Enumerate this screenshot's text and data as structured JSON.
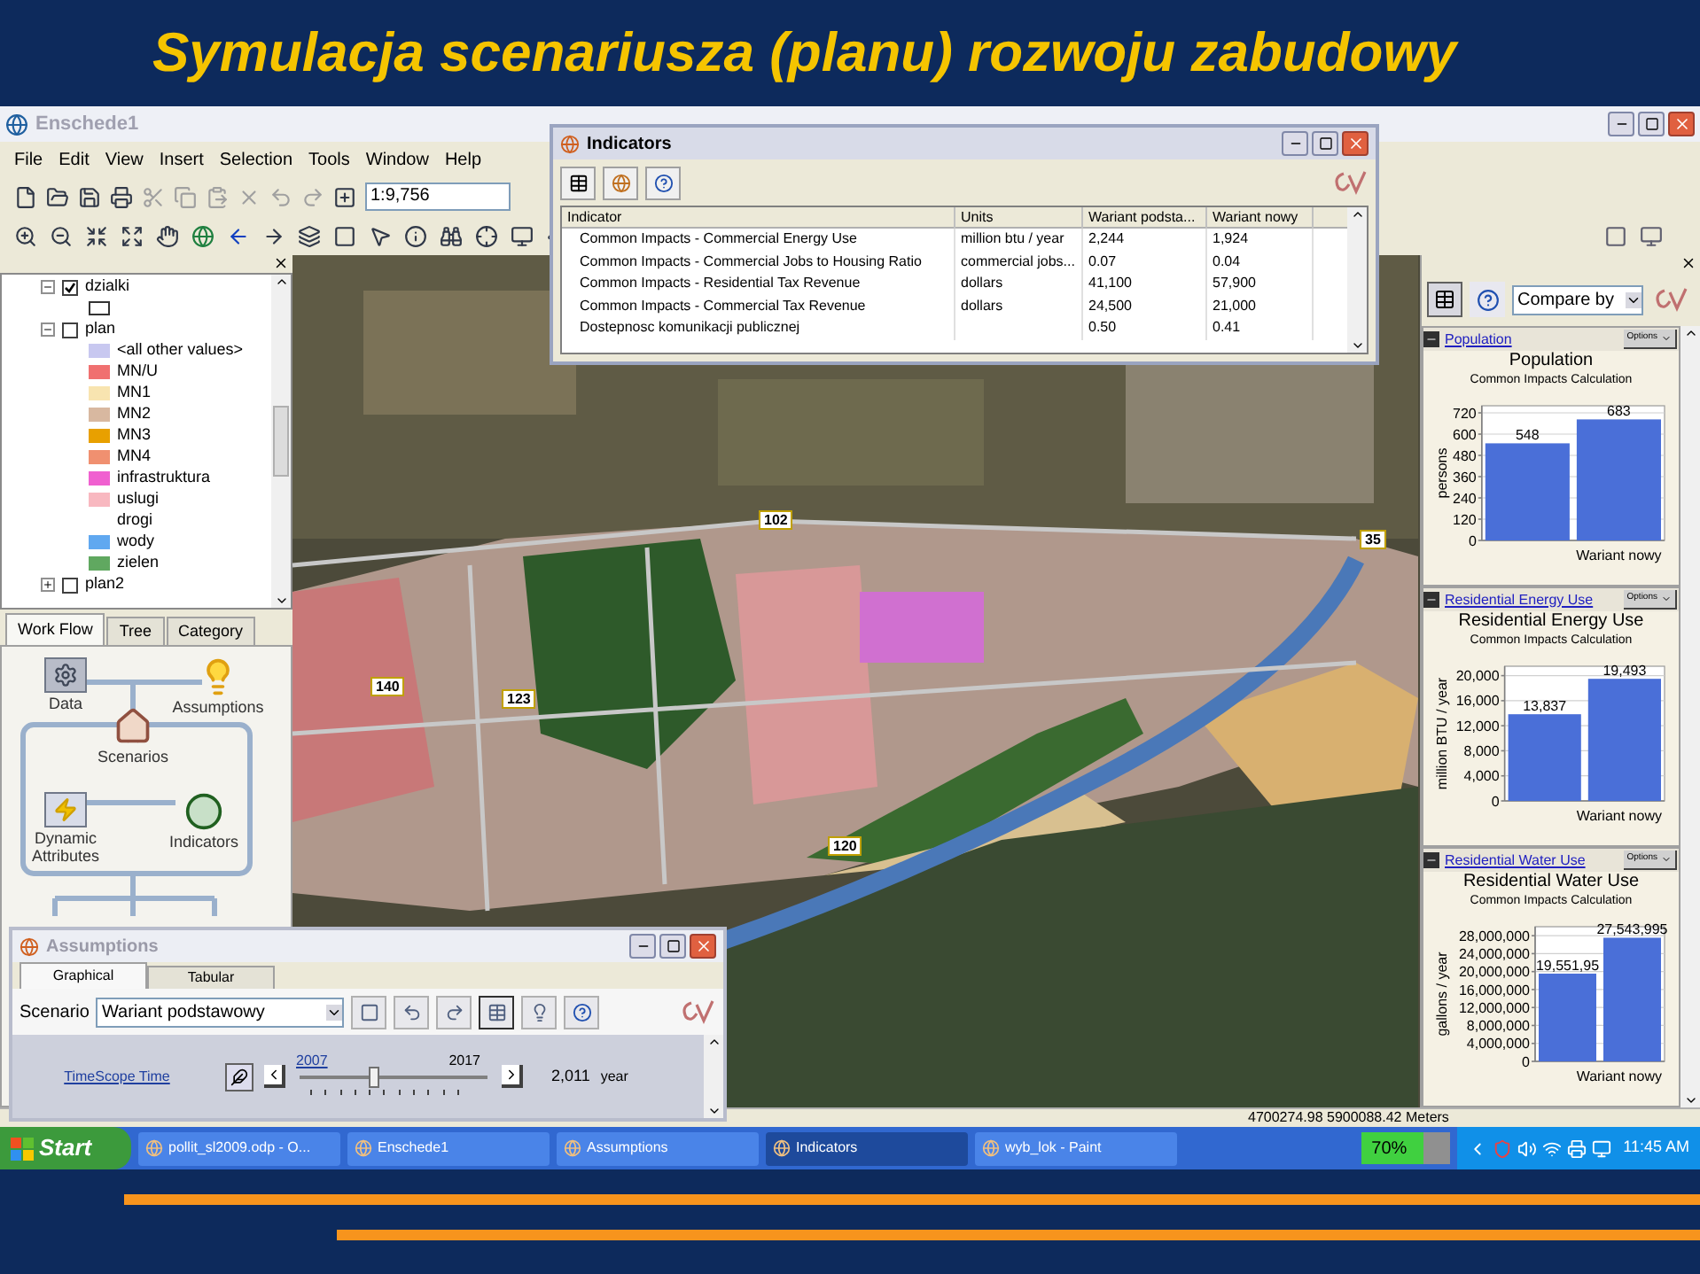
{
  "slide": {
    "title": "Symulacja scenariusza (planu) rozwoju zabudowy"
  },
  "app": {
    "title": "Enschede1",
    "active": false,
    "menu": [
      "File",
      "Edit",
      "View",
      "Insert",
      "Selection",
      "Tools",
      "Window",
      "Help"
    ],
    "scale": "1:9,756"
  },
  "toc": [
    {
      "label": "dzialki",
      "checked": true,
      "expanded": true,
      "legend": [
        {
          "kind": "outline",
          "color": "#ffffff"
        }
      ]
    },
    {
      "label": "plan",
      "checked": false,
      "expanded": true,
      "legend": [
        {
          "kind": "swatch",
          "label": "<all other values>",
          "color": "#c8c8f0"
        },
        {
          "kind": "swatch",
          "label": "MN/U",
          "color": "#f07070"
        },
        {
          "kind": "swatch",
          "label": "MN1",
          "color": "#f8e4b0"
        },
        {
          "kind": "swatch",
          "label": "MN2",
          "color": "#d8b8a0"
        },
        {
          "kind": "swatch",
          "label": "MN3",
          "color": "#e8a000"
        },
        {
          "kind": "swatch",
          "label": "MN4",
          "color": "#f09070"
        },
        {
          "kind": "swatch",
          "label": "infrastruktura",
          "color": "#f060d0"
        },
        {
          "kind": "swatch",
          "label": "uslugi",
          "color": "#f8b8c0"
        },
        {
          "kind": "blank",
          "label": "drogi"
        },
        {
          "kind": "swatch",
          "label": "wody",
          "color": "#60a8f0"
        },
        {
          "kind": "swatch",
          "label": "zielen",
          "color": "#60a860"
        }
      ]
    },
    {
      "label": "plan2",
      "checked": false,
      "expanded": false
    }
  ],
  "left_tabs": [
    {
      "label": "Work Flow",
      "selected": true
    },
    {
      "label": "Tree",
      "selected": false
    },
    {
      "label": "Category",
      "selected": false
    }
  ],
  "workflow": [
    {
      "kind": "data",
      "label": "Data"
    },
    {
      "kind": "assumptions",
      "label": "Assumptions"
    },
    {
      "kind": "scenarios",
      "label": "Scenarios"
    },
    {
      "kind": "dynamic",
      "label": "Dynamic Attributes"
    },
    {
      "kind": "indicators",
      "label": "Indicators"
    }
  ],
  "map": {
    "labels": [
      "102",
      "35",
      "140",
      "123",
      "120"
    ]
  },
  "indicators_window": {
    "title": "Indicators",
    "active": true,
    "columns": [
      "Indicator",
      "Units",
      "Wariant podsta...",
      "Wariant nowy"
    ],
    "rows": [
      [
        "Common Impacts - Commercial Energy Use",
        "million btu / year",
        "2,244",
        "1,924"
      ],
      [
        "Common Impacts - Commercial Jobs to Housing Ratio",
        "commercial jobs...",
        "0.07",
        "0.04"
      ],
      [
        "Common Impacts - Residential Tax Revenue",
        "dollars",
        "41,100",
        "57,900"
      ],
      [
        "Common Impacts - Commercial Tax Revenue",
        "dollars",
        "24,500",
        "21,000"
      ],
      [
        "Dostepnosc komunikacji publicznej",
        null,
        "0.50",
        "0.41"
      ]
    ]
  },
  "right_panel": {
    "compare": "Compare by",
    "sections": [
      {
        "link": "Population",
        "options": "Options",
        "subtitle": "Common Impacts Calculation",
        "chart_data": {
          "type": "bar",
          "title": "Population",
          "ylabel": "persons",
          "categories": [
            null,
            "Wariant nowy"
          ],
          "values": [
            548,
            683
          ],
          "grid": true,
          "ylim": [
            0,
            760
          ],
          "yticks": [
            0,
            120,
            240,
            360,
            480,
            600,
            720
          ],
          "value_labels": [
            "548",
            "683"
          ]
        }
      },
      {
        "link": "Residential Energy Use",
        "options": "Options",
        "subtitle": "Common Impacts Calculation",
        "chart_data": {
          "type": "bar",
          "title": "Residential Energy Use",
          "ylabel": "million BTU / year",
          "categories": [
            null,
            "Wariant nowy"
          ],
          "values": [
            13837,
            19493
          ],
          "grid": true,
          "ylim": [
            0,
            21500
          ],
          "yticks": [
            0,
            {
              "value": 4000,
              "label": "4,000"
            },
            {
              "value": 8000,
              "label": "8,000"
            },
            {
              "value": 12000,
              "label": "12,000"
            },
            {
              "value": 16000,
              "label": "16,000"
            },
            {
              "value": 20000,
              "label": "20,000"
            }
          ],
          "value_labels": [
            "13,837",
            "19,493"
          ]
        }
      },
      {
        "link": "Residential Water Use",
        "options": "Options",
        "subtitle": "Common Impacts Calculation",
        "chart_data": {
          "type": "bar",
          "title": "Residential Water Use",
          "ylabel": "gallons / year",
          "categories": [
            null,
            "Wariant nowy"
          ],
          "values": [
            19550000,
            27543995
          ],
          "ylim": [
            0,
            30000000
          ],
          "yticks": [
            0,
            {
              "value": 4000000,
              "label": "4,000,000"
            },
            {
              "value": 8000000,
              "label": "8,000,000"
            },
            {
              "value": 12000000,
              "label": "12,000,000"
            },
            {
              "value": 16000000,
              "label": "16,000,000"
            },
            {
              "value": 20000000,
              "label": "20,000,000"
            },
            {
              "value": 24000000,
              "label": "24,000,000"
            },
            {
              "value": 28000000,
              "label": "28,000,000"
            }
          ],
          "grid": true,
          "value_labels": [
            "19,551,95",
            "27,543,995"
          ]
        }
      }
    ]
  },
  "assumptions_window": {
    "title": "Assumptions",
    "active": false,
    "tabs": [
      {
        "label": "Graphical",
        "selected": true
      },
      {
        "label": "Tabular",
        "selected": false
      }
    ],
    "scenario_label": "Scenario",
    "scenario": "Wariant podstawowy",
    "variable": "TimeScope Time",
    "start": "2007",
    "end": "2017",
    "level": 0.4,
    "reading": "2,011",
    "unit": "year"
  },
  "status_bar": {
    "coords": "4700274.98 5900088.42 Meters"
  },
  "taskbar": {
    "start": "Start",
    "items": [
      {
        "label": "pollit_sl2009.odp - O...",
        "selected": false
      },
      {
        "label": "Enschede1",
        "selected": false
      },
      {
        "label": "Assumptions",
        "selected": false
      },
      {
        "label": "Indicators",
        "selected": true
      },
      {
        "label": "wyb_lok - Paint",
        "selected": false
      }
    ],
    "battery": {
      "text": "70%",
      "level": 0.7
    },
    "clock": "11:45 AM"
  }
}
